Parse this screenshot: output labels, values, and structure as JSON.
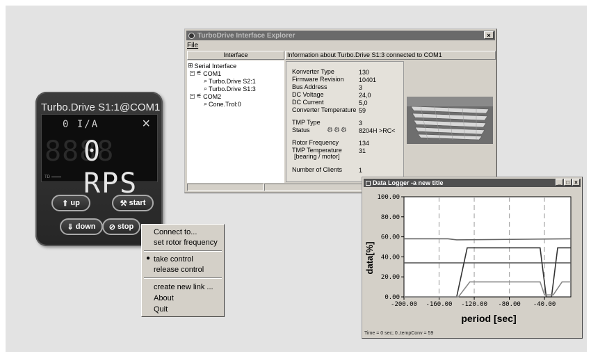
{
  "device": {
    "title": "Turbo.Drive S1:1@COM1",
    "lcd_top": "0 I/A",
    "lcd_close": "×",
    "lcd_ghost": "8888",
    "lcd_main": "0 RPS",
    "lcd_footer": "TD",
    "buttons": {
      "up": "up",
      "start": "start",
      "down": "down",
      "stop": "stop"
    }
  },
  "context_menu": {
    "items": [
      {
        "label": "Connect to...",
        "accel": "C"
      },
      {
        "label": "set rotor frequency",
        "accel": "s"
      },
      {
        "label": "take control",
        "accel": "t",
        "checked": true
      },
      {
        "label": "release control",
        "accel": "r"
      },
      {
        "label": "create new link ...",
        "accel": "e"
      },
      {
        "label": "About",
        "accel": "A"
      },
      {
        "label": "Quit",
        "accel": "Q"
      }
    ]
  },
  "explorer": {
    "title": "TurboDrive Interface Explorer",
    "close": "×",
    "menu_file": "File",
    "tree_header": "Interface",
    "info_header": "Information about Turbo.Drive S1:3 connected to COM1",
    "tree": {
      "root": "Serial Interface",
      "com1": "COM1",
      "com1_children": [
        "Turbo.Drive S2:1",
        "Turbo.Drive S1:3"
      ],
      "com2": "COM2",
      "com2_children": [
        "Cone.Trol:0"
      ]
    },
    "info": {
      "converter_type_label": "Konverter Type",
      "converter_type": "130",
      "firmware_label": "Firmware Revision",
      "firmware": "10401",
      "bus_address_label": "Bus Address",
      "bus_address": "3",
      "dc_voltage_label": "DC Voltage",
      "dc_voltage": "24,0",
      "dc_current_label": "DC Current",
      "dc_current": "5,0",
      "conv_temp_label": "Converter Temperature",
      "conv_temp": "59",
      "tmp_type_label": "TMP Type",
      "tmp_type": "3",
      "status_label": "Status",
      "status": "8204H  >RC<",
      "rotor_freq_label": "Rotor Frequency",
      "rotor_freq": "134",
      "tmp_temp_label": "TMP Temperature",
      "tmp_temp_sub": "[bearing / motor]",
      "tmp_temp": "31",
      "clients_label": "Number of Clients",
      "clients": "1"
    }
  },
  "logger": {
    "title": "Data Logger -a new title",
    "status": "Time = 0 sec; 0..tempConv = 59"
  },
  "chart_data": {
    "type": "line",
    "title": "",
    "xlabel": "period [sec]",
    "ylabel": "data[%]",
    "xlim": [
      -200,
      -10
    ],
    "ylim": [
      0,
      100
    ],
    "xticks": [
      -200,
      -160,
      -120,
      -80,
      -40
    ],
    "yticks": [
      0,
      20,
      40,
      60,
      80,
      100
    ],
    "xtick_labels": [
      "-200.00",
      "-160.00",
      "-120.00",
      "-80.00",
      "-40.00"
    ],
    "ytick_labels": [
      "0.00",
      "20.00",
      "40.00",
      "60.00",
      "80.00",
      "100.00"
    ],
    "vlines_dashed": [
      -160,
      -120,
      -80,
      -40
    ],
    "series": [
      {
        "color": "#666666",
        "x": [
          -200,
          -150,
          -140,
          -10
        ],
        "y": [
          58,
          58,
          57,
          58
        ]
      },
      {
        "color": "#555555",
        "x": [
          -200,
          -10
        ],
        "y": [
          34,
          34
        ]
      },
      {
        "color": "#333333",
        "x": [
          -200,
          -140,
          -128,
          -45,
          -38,
          -32,
          -25,
          -10
        ],
        "y": [
          0,
          0,
          49,
          49,
          0,
          0,
          49,
          49
        ]
      },
      {
        "color": "#888888",
        "x": [
          -200,
          -138,
          -125,
          -45,
          -40,
          -30,
          -20,
          -10
        ],
        "y": [
          0,
          0,
          15,
          15,
          2,
          2,
          15,
          15
        ]
      }
    ]
  }
}
